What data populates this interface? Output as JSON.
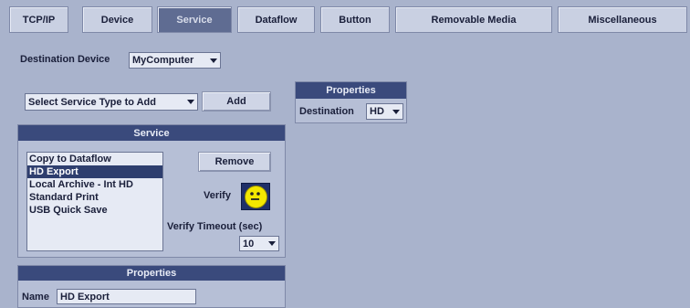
{
  "tabs": [
    {
      "label": "TCP/IP",
      "active": false
    },
    {
      "label": "Device",
      "active": false
    },
    {
      "label": "Service",
      "active": true
    },
    {
      "label": "Dataflow",
      "active": false
    },
    {
      "label": "Button",
      "active": false
    },
    {
      "label": "Removable Media",
      "active": false
    },
    {
      "label": "Miscellaneous",
      "active": false
    }
  ],
  "destination_device": {
    "label": "Destination Device",
    "value": "MyComputer"
  },
  "add_service": {
    "select_placeholder": "Select Service Type to Add",
    "add_label": "Add"
  },
  "service_panel": {
    "title": "Service",
    "items": [
      "Copy to Dataflow",
      "HD Export",
      "Local Archive - Int HD",
      "Standard Print",
      "USB Quick Save"
    ],
    "selected_index": 1,
    "remove_label": "Remove",
    "verify_label": "Verify",
    "verify_timeout_label": "Verify Timeout (sec)",
    "verify_timeout_value": "10"
  },
  "properties_bottom": {
    "title": "Properties",
    "name_label": "Name",
    "name_value": "HD Export"
  },
  "properties_right": {
    "title": "Properties",
    "destination_label": "Destination",
    "destination_value": "HD"
  },
  "colors": {
    "header": "#3a4a7c",
    "background": "#a9b3cc",
    "active_tab": "#5f6c92",
    "smiley": "#f3e700"
  },
  "icons": {
    "verify": "smiley-face-icon",
    "dropdown": "chevron-down-icon"
  }
}
